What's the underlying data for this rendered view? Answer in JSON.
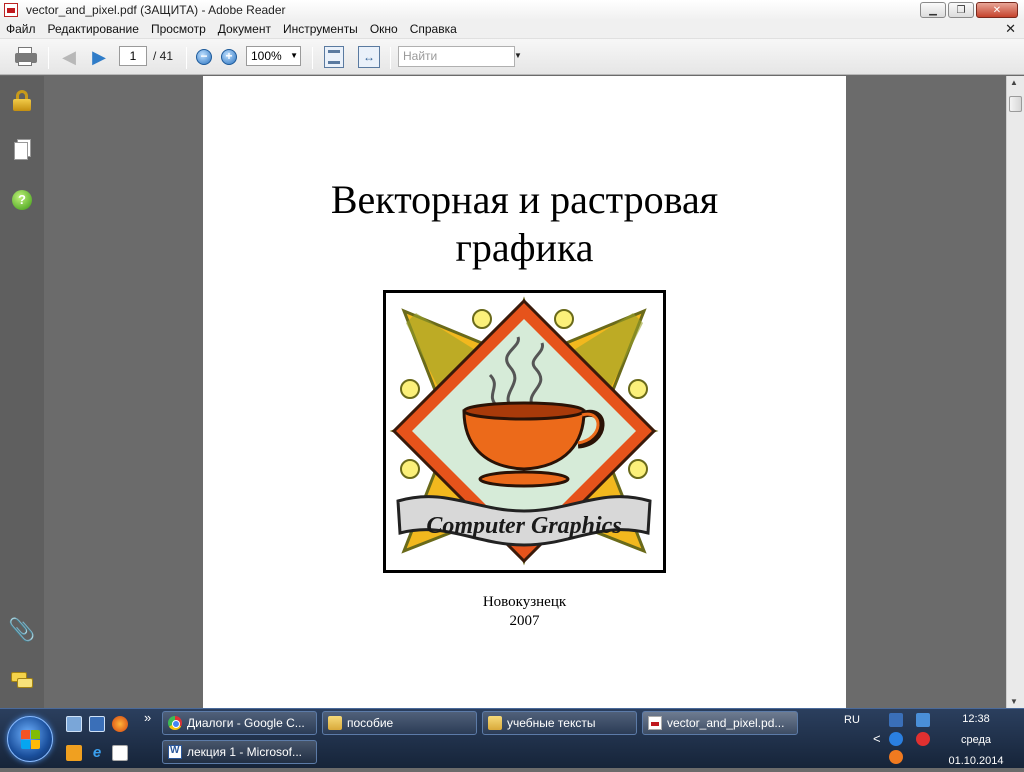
{
  "window": {
    "title": "vector_and_pixel.pdf (ЗАЩИТА) - Adobe Reader",
    "minimize": "▁",
    "maximize": "❐",
    "close": "✕"
  },
  "menubar": {
    "items": [
      "Файл",
      "Редактирование",
      "Просмотр",
      "Документ",
      "Инструменты",
      "Окно",
      "Справка"
    ],
    "close_glyph": "✕"
  },
  "toolbar": {
    "current_page": "1",
    "total_pages": "/ 41",
    "zoom_out": "−",
    "zoom_in": "+",
    "zoom_level": "100%",
    "search_placeholder": "Найти",
    "icons": [
      "printer-icon",
      "prev-page-icon",
      "next-page-icon",
      "zoom-out-icon",
      "zoom-in-icon",
      "fit-page-icon",
      "fit-width-icon"
    ]
  },
  "left_panel": {
    "icons": [
      "lock-icon",
      "pages-icon",
      "help-icon",
      "attachments-icon",
      "comments-icon"
    ],
    "help_glyph": "?",
    "clip_glyph": "📎"
  },
  "document": {
    "title_line1": "Векторная и растровая",
    "title_line2": "графика",
    "logo_text": "Computer Graphics",
    "city": "Новокузнецк",
    "year": "2007"
  },
  "scrollbar": {
    "up": "▲",
    "down": "▼"
  },
  "taskbar": {
    "quicklaunch_more": "»",
    "tasks_row1": [
      {
        "label": "Диалоги - Google C...",
        "icon": "chrome"
      },
      {
        "label": "пособие",
        "icon": "folder"
      },
      {
        "label": "учебные тексты",
        "icon": "folder"
      },
      {
        "label": "vector_and_pixel.pd...",
        "icon": "pdf"
      }
    ],
    "tasks_row2": [
      {
        "label": "лекция 1 - Microsof...",
        "icon": "word"
      }
    ],
    "language": "RU",
    "tray_chevron": "<",
    "time": "12:38",
    "weekday": "среда",
    "date": "01.10.2014"
  }
}
